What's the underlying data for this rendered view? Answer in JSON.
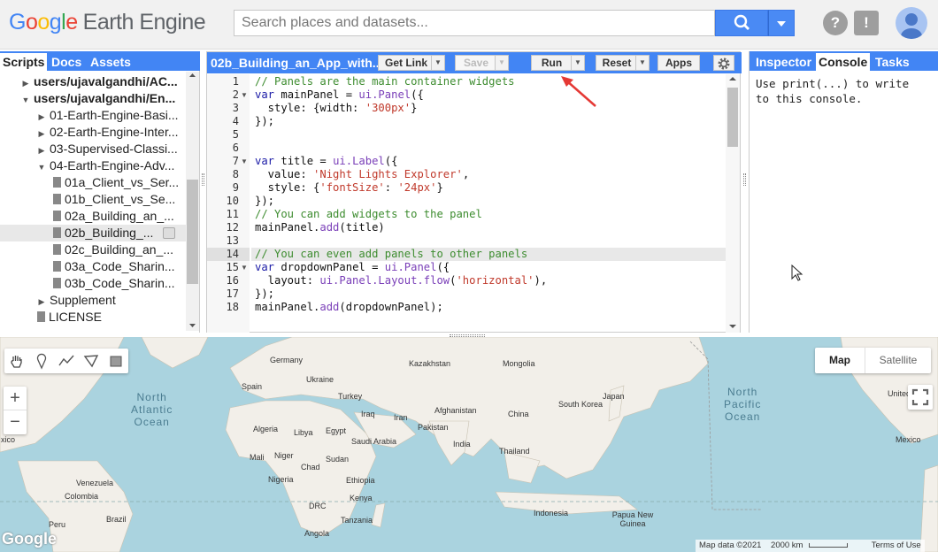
{
  "header": {
    "logo_letters": [
      "G",
      "o",
      "o",
      "g",
      "l",
      "e"
    ],
    "logo_suffix": "Earth Engine",
    "search_placeholder": "Search places and datasets...",
    "help_icon": "?",
    "feedback_icon": "!"
  },
  "left_panel": {
    "tabs": [
      "Scripts",
      "Docs",
      "Assets"
    ],
    "active_tab": "Scripts",
    "tree": [
      {
        "label": "users/ujavalgandhi/AC...",
        "indent": 1,
        "expanded": false,
        "bold": true
      },
      {
        "label": "users/ujavalgandhi/En...",
        "indent": 1,
        "expanded": true,
        "bold": true
      },
      {
        "label": "01-Earth-Engine-Basi...",
        "indent": 2,
        "expanded": false
      },
      {
        "label": "02-Earth-Engine-Inter...",
        "indent": 2,
        "expanded": false
      },
      {
        "label": "03-Supervised-Classi...",
        "indent": 2,
        "expanded": false
      },
      {
        "label": "04-Earth-Engine-Adv...",
        "indent": 2,
        "expanded": true
      },
      {
        "label": "01a_Client_vs_Ser...",
        "indent": 3,
        "file": true
      },
      {
        "label": "01b_Client_vs_Se...",
        "indent": 3,
        "file": true
      },
      {
        "label": "02a_Building_an_...",
        "indent": 3,
        "file": true
      },
      {
        "label": "02b_Building_...",
        "indent": 3,
        "file": true,
        "selected": true
      },
      {
        "label": "02c_Building_an_...",
        "indent": 3,
        "file": true
      },
      {
        "label": "03a_Code_Sharin...",
        "indent": 3,
        "file": true
      },
      {
        "label": "03b_Code_Sharin...",
        "indent": 3,
        "file": true
      },
      {
        "label": "Supplement",
        "indent": 2,
        "expanded": false
      },
      {
        "label": "LICENSE",
        "indent": 2,
        "file": true
      }
    ]
  },
  "editor": {
    "file_title": "02b_Building_an_App_with...",
    "buttons": {
      "get_link": "Get Link",
      "save": "Save",
      "run": "Run",
      "reset": "Reset",
      "apps": "Apps"
    },
    "lines": [
      {
        "n": "1",
        "tokens": [
          [
            "cmt",
            "// Panels are the main container widgets"
          ]
        ]
      },
      {
        "n": "2",
        "tokens": [
          [
            "kw",
            "var "
          ],
          [
            "plain",
            "mainPanel = "
          ],
          [
            "fn",
            "ui.Panel"
          ],
          [
            "plain",
            "({"
          ]
        ]
      },
      {
        "n": "3",
        "tokens": [
          [
            "plain",
            "  style: {width: "
          ],
          [
            "str",
            "'300px'"
          ],
          [
            "plain",
            "}"
          ]
        ]
      },
      {
        "n": "4",
        "tokens": [
          [
            "plain",
            "});"
          ]
        ]
      },
      {
        "n": "5",
        "tokens": []
      },
      {
        "n": "6",
        "tokens": []
      },
      {
        "n": "7",
        "tokens": [
          [
            "kw",
            "var "
          ],
          [
            "plain",
            "title = "
          ],
          [
            "fn",
            "ui.Label"
          ],
          [
            "plain",
            "({"
          ]
        ]
      },
      {
        "n": "8",
        "tokens": [
          [
            "plain",
            "  value: "
          ],
          [
            "str",
            "'Night Lights Explorer'"
          ],
          [
            "plain",
            ","
          ]
        ]
      },
      {
        "n": "9",
        "tokens": [
          [
            "plain",
            "  style: {"
          ],
          [
            "str",
            "'fontSize'"
          ],
          [
            "plain",
            ": "
          ],
          [
            "str",
            "'24px'"
          ],
          [
            "plain",
            "}"
          ]
        ]
      },
      {
        "n": "10",
        "tokens": [
          [
            "plain",
            "});"
          ]
        ]
      },
      {
        "n": "11",
        "tokens": [
          [
            "cmt",
            "// You can add widgets to the panel"
          ]
        ]
      },
      {
        "n": "12",
        "tokens": [
          [
            "plain",
            "mainPanel."
          ],
          [
            "fn",
            "add"
          ],
          [
            "plain",
            "(title)"
          ]
        ]
      },
      {
        "n": "13",
        "tokens": []
      },
      {
        "n": "14",
        "tokens": [
          [
            "cmt",
            "// You can even add panels to other panels"
          ]
        ],
        "highlight": true
      },
      {
        "n": "15",
        "tokens": [
          [
            "kw",
            "var "
          ],
          [
            "plain",
            "dropdownPanel = "
          ],
          [
            "fn",
            "ui.Panel"
          ],
          [
            "plain",
            "({"
          ]
        ]
      },
      {
        "n": "16",
        "tokens": [
          [
            "plain",
            "  layout: "
          ],
          [
            "fn",
            "ui.Panel.Layout.flow"
          ],
          [
            "plain",
            "("
          ],
          [
            "str",
            "'horizontal'"
          ],
          [
            "plain",
            "),"
          ]
        ]
      },
      {
        "n": "17",
        "tokens": [
          [
            "plain",
            "});"
          ]
        ]
      },
      {
        "n": "18",
        "tokens": [
          [
            "plain",
            "mainPanel."
          ],
          [
            "fn",
            "add"
          ],
          [
            "plain",
            "(dropdownPanel);"
          ]
        ]
      }
    ]
  },
  "right_panel": {
    "tabs": [
      "Inspector",
      "Console",
      "Tasks"
    ],
    "active_tab": "Console",
    "console_text": "Use print(...) to write\nto this console."
  },
  "map": {
    "map_type": {
      "map": "Map",
      "satellite": "Satellite",
      "active": "Map"
    },
    "zoom_in": "+",
    "zoom_out": "−",
    "oceans": [
      {
        "name": "North\nAtlantic\nOcean"
      },
      {
        "name": "North\nPacific\nOcean"
      }
    ],
    "labels": [
      "Germany",
      "Kazakhstan",
      "Mongolia",
      "Spain",
      "Ukraine",
      "Turkey",
      "Japan",
      "Iraq",
      "Iran",
      "Afghanistan",
      "South Korea",
      "China",
      "Algeria",
      "Libya",
      "Egypt",
      "Pakistan",
      "Saudi Arabia",
      "India",
      "Mali",
      "Niger",
      "Sudan",
      "Chad",
      "Thailand",
      "Nigeria",
      "Ethiopia",
      "Venezuela",
      "Colombia",
      "Kenya",
      "DRC",
      "Tanzania",
      "Indonesia",
      "Papua New Guinea",
      "Peru",
      "Brazil",
      "Angola",
      "Mexico",
      "United",
      "xico"
    ],
    "attribution": {
      "map_data": "Map data ©2021",
      "scale": "2000 km",
      "terms": "Terms of Use"
    },
    "google_logo": "Google"
  },
  "colors": {
    "accent": "#4285f4",
    "ocean": "#aad3df",
    "land": "#f2efe9",
    "arrow": "#e53935"
  }
}
